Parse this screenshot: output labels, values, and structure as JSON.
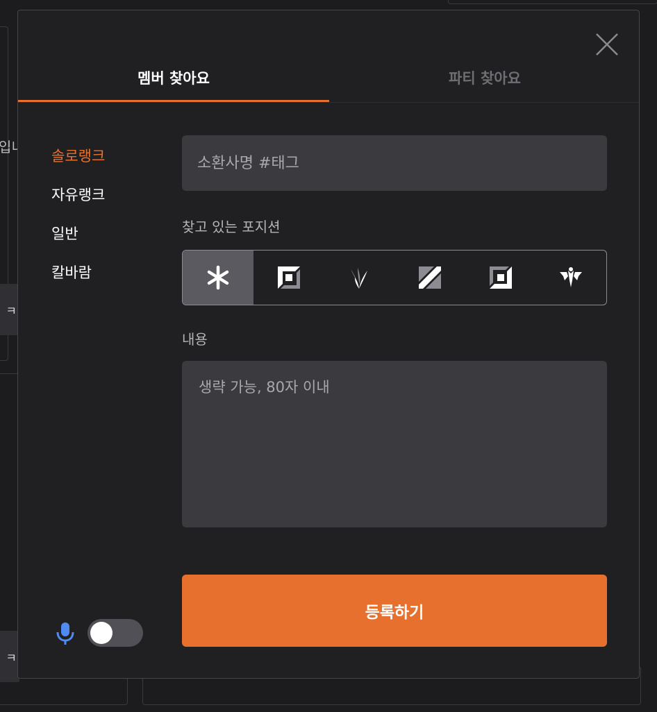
{
  "background": {
    "partial_text_1": "입니",
    "card_text_1": "ㅋ",
    "card_text_2": "ㅋ"
  },
  "modal": {
    "close_icon": "close-x-icon",
    "tabs": [
      {
        "label": "멤버 찾아요",
        "active": true
      },
      {
        "label": "파티 찾아요",
        "active": false
      }
    ],
    "queue_types": [
      {
        "label": "솔로랭크",
        "active": true
      },
      {
        "label": "자유랭크",
        "active": false
      },
      {
        "label": "일반",
        "active": false
      },
      {
        "label": "칼바람",
        "active": false
      }
    ],
    "summoner_input": {
      "placeholder": "소환사명 #태그",
      "value": ""
    },
    "position_label": "찾고 있는 포지션",
    "positions": [
      {
        "icon": "all-positions-icon",
        "selected": true
      },
      {
        "icon": "top-lane-icon",
        "selected": false
      },
      {
        "icon": "jungle-icon",
        "selected": false
      },
      {
        "icon": "mid-lane-icon",
        "selected": false
      },
      {
        "icon": "bottom-lane-icon",
        "selected": false
      },
      {
        "icon": "support-icon",
        "selected": false
      }
    ],
    "content_label": "내용",
    "content_textarea": {
      "placeholder": "생략 가능, 80자 이내",
      "value": ""
    },
    "submit_label": "등록하기",
    "mic_icon": "microphone-icon",
    "mic_toggle_on": false
  },
  "colors": {
    "accent": "#e8702f",
    "modal_bg": "#202023",
    "field_bg": "#3a3a3f",
    "mic_blue": "#4f8bf0"
  }
}
